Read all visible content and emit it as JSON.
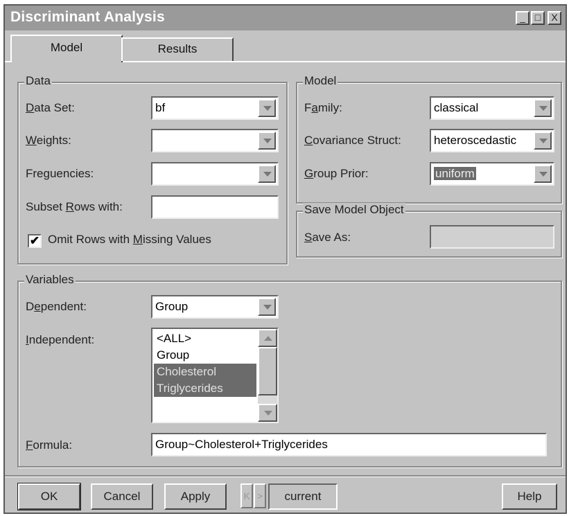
{
  "window": {
    "title": "Discriminant Analysis",
    "minimize_glyph": "_",
    "maximize_glyph": "□",
    "close_glyph": "X"
  },
  "tabs": [
    {
      "label": "Model",
      "active": true
    },
    {
      "label": "Results",
      "active": false
    }
  ],
  "data_group": {
    "legend": "Data",
    "data_set": {
      "label_u": "D",
      "label_rest": "ata Set:",
      "value": "bf"
    },
    "weights": {
      "label_u": "W",
      "label_rest": "eights:",
      "value": ""
    },
    "frequencies": {
      "label": "Freguencies:",
      "value": ""
    },
    "subset_rows": {
      "label_pre": "Subset ",
      "label_u": "R",
      "label_rest": "ows with:",
      "value": ""
    },
    "omit_rows": {
      "label_pre": "Omit Rows with ",
      "label_u": "M",
      "label_rest": "issing Values",
      "checked": true,
      "check_glyph": "✔"
    }
  },
  "model_group": {
    "legend": "Model",
    "family": {
      "label_pre": "F",
      "label_u": "a",
      "label_rest": "mily:",
      "value": "classical"
    },
    "covariance": {
      "label_u": "C",
      "label_rest": "ovariance Struct:",
      "value": "heteroscedastic"
    },
    "group_prior": {
      "label_u": "G",
      "label_rest": "roup Prior:",
      "value": "uniform"
    }
  },
  "save_group": {
    "legend": "Save Model Object",
    "save_as": {
      "label_u": "S",
      "label_rest": "ave As:",
      "value": ""
    }
  },
  "variables_group": {
    "legend": "Variables",
    "dependent": {
      "label_pre": "D",
      "label_u": "e",
      "label_rest": "pendent:",
      "value": "Group"
    },
    "independent": {
      "label_u": "I",
      "label_rest": "ndependent:",
      "items": [
        {
          "text": "<ALL>",
          "selected": false
        },
        {
          "text": "Group",
          "selected": false
        },
        {
          "text": "Cholesterol",
          "selected": true
        },
        {
          "text": "Triglycerides",
          "selected": true
        }
      ]
    },
    "formula": {
      "label_u": "F",
      "label_rest": "ormula:",
      "value": "Group~Cholesterol+Triglycerides"
    }
  },
  "footer": {
    "ok": "OK",
    "cancel": "Cancel",
    "apply": "Apply",
    "prev_glyph": "K",
    "next_glyph": ">",
    "current": "current",
    "help": "Help"
  }
}
